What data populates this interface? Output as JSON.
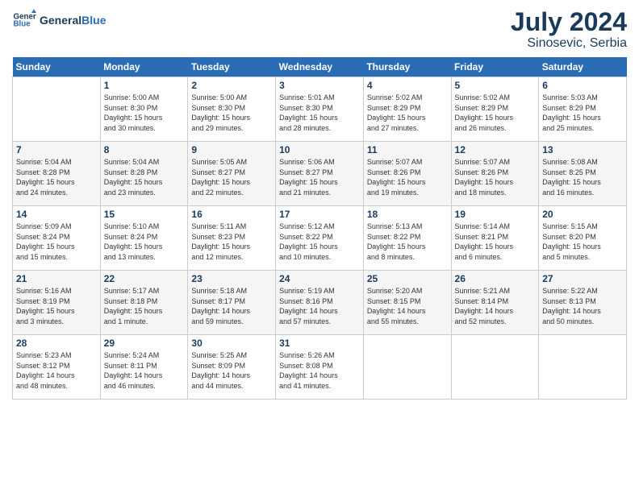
{
  "header": {
    "logo_line1": "General",
    "logo_line2": "Blue",
    "month": "July 2024",
    "location": "Sinosevic, Serbia"
  },
  "days_of_week": [
    "Sunday",
    "Monday",
    "Tuesday",
    "Wednesday",
    "Thursday",
    "Friday",
    "Saturday"
  ],
  "weeks": [
    [
      {
        "day": "",
        "info": ""
      },
      {
        "day": "1",
        "info": "Sunrise: 5:00 AM\nSunset: 8:30 PM\nDaylight: 15 hours\nand 30 minutes."
      },
      {
        "day": "2",
        "info": "Sunrise: 5:00 AM\nSunset: 8:30 PM\nDaylight: 15 hours\nand 29 minutes."
      },
      {
        "day": "3",
        "info": "Sunrise: 5:01 AM\nSunset: 8:30 PM\nDaylight: 15 hours\nand 28 minutes."
      },
      {
        "day": "4",
        "info": "Sunrise: 5:02 AM\nSunset: 8:29 PM\nDaylight: 15 hours\nand 27 minutes."
      },
      {
        "day": "5",
        "info": "Sunrise: 5:02 AM\nSunset: 8:29 PM\nDaylight: 15 hours\nand 26 minutes."
      },
      {
        "day": "6",
        "info": "Sunrise: 5:03 AM\nSunset: 8:29 PM\nDaylight: 15 hours\nand 25 minutes."
      }
    ],
    [
      {
        "day": "7",
        "info": "Sunrise: 5:04 AM\nSunset: 8:28 PM\nDaylight: 15 hours\nand 24 minutes."
      },
      {
        "day": "8",
        "info": "Sunrise: 5:04 AM\nSunset: 8:28 PM\nDaylight: 15 hours\nand 23 minutes."
      },
      {
        "day": "9",
        "info": "Sunrise: 5:05 AM\nSunset: 8:27 PM\nDaylight: 15 hours\nand 22 minutes."
      },
      {
        "day": "10",
        "info": "Sunrise: 5:06 AM\nSunset: 8:27 PM\nDaylight: 15 hours\nand 21 minutes."
      },
      {
        "day": "11",
        "info": "Sunrise: 5:07 AM\nSunset: 8:26 PM\nDaylight: 15 hours\nand 19 minutes."
      },
      {
        "day": "12",
        "info": "Sunrise: 5:07 AM\nSunset: 8:26 PM\nDaylight: 15 hours\nand 18 minutes."
      },
      {
        "day": "13",
        "info": "Sunrise: 5:08 AM\nSunset: 8:25 PM\nDaylight: 15 hours\nand 16 minutes."
      }
    ],
    [
      {
        "day": "14",
        "info": "Sunrise: 5:09 AM\nSunset: 8:24 PM\nDaylight: 15 hours\nand 15 minutes."
      },
      {
        "day": "15",
        "info": "Sunrise: 5:10 AM\nSunset: 8:24 PM\nDaylight: 15 hours\nand 13 minutes."
      },
      {
        "day": "16",
        "info": "Sunrise: 5:11 AM\nSunset: 8:23 PM\nDaylight: 15 hours\nand 12 minutes."
      },
      {
        "day": "17",
        "info": "Sunrise: 5:12 AM\nSunset: 8:22 PM\nDaylight: 15 hours\nand 10 minutes."
      },
      {
        "day": "18",
        "info": "Sunrise: 5:13 AM\nSunset: 8:22 PM\nDaylight: 15 hours\nand 8 minutes."
      },
      {
        "day": "19",
        "info": "Sunrise: 5:14 AM\nSunset: 8:21 PM\nDaylight: 15 hours\nand 6 minutes."
      },
      {
        "day": "20",
        "info": "Sunrise: 5:15 AM\nSunset: 8:20 PM\nDaylight: 15 hours\nand 5 minutes."
      }
    ],
    [
      {
        "day": "21",
        "info": "Sunrise: 5:16 AM\nSunset: 8:19 PM\nDaylight: 15 hours\nand 3 minutes."
      },
      {
        "day": "22",
        "info": "Sunrise: 5:17 AM\nSunset: 8:18 PM\nDaylight: 15 hours\nand 1 minute."
      },
      {
        "day": "23",
        "info": "Sunrise: 5:18 AM\nSunset: 8:17 PM\nDaylight: 14 hours\nand 59 minutes."
      },
      {
        "day": "24",
        "info": "Sunrise: 5:19 AM\nSunset: 8:16 PM\nDaylight: 14 hours\nand 57 minutes."
      },
      {
        "day": "25",
        "info": "Sunrise: 5:20 AM\nSunset: 8:15 PM\nDaylight: 14 hours\nand 55 minutes."
      },
      {
        "day": "26",
        "info": "Sunrise: 5:21 AM\nSunset: 8:14 PM\nDaylight: 14 hours\nand 52 minutes."
      },
      {
        "day": "27",
        "info": "Sunrise: 5:22 AM\nSunset: 8:13 PM\nDaylight: 14 hours\nand 50 minutes."
      }
    ],
    [
      {
        "day": "28",
        "info": "Sunrise: 5:23 AM\nSunset: 8:12 PM\nDaylight: 14 hours\nand 48 minutes."
      },
      {
        "day": "29",
        "info": "Sunrise: 5:24 AM\nSunset: 8:11 PM\nDaylight: 14 hours\nand 46 minutes."
      },
      {
        "day": "30",
        "info": "Sunrise: 5:25 AM\nSunset: 8:09 PM\nDaylight: 14 hours\nand 44 minutes."
      },
      {
        "day": "31",
        "info": "Sunrise: 5:26 AM\nSunset: 8:08 PM\nDaylight: 14 hours\nand 41 minutes."
      },
      {
        "day": "",
        "info": ""
      },
      {
        "day": "",
        "info": ""
      },
      {
        "day": "",
        "info": ""
      }
    ]
  ]
}
